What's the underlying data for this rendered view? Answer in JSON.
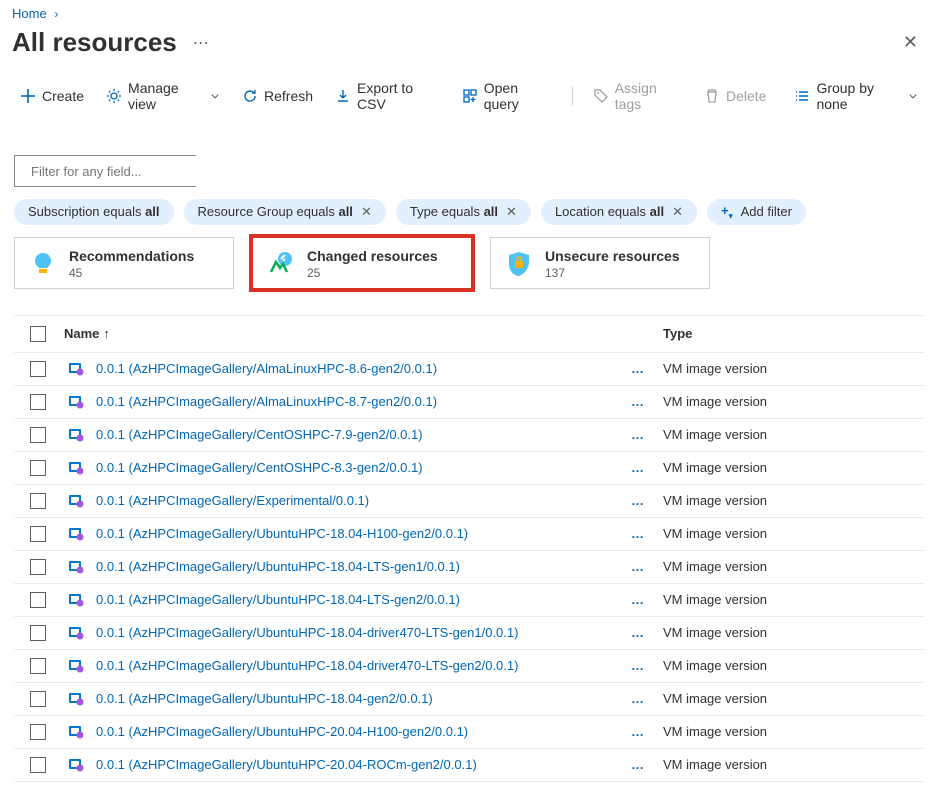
{
  "breadcrumb": {
    "home": "Home"
  },
  "title": "All resources",
  "cmdbar": {
    "create": "Create",
    "manage_view": "Manage view",
    "refresh": "Refresh",
    "export_csv": "Export to CSV",
    "open_query": "Open query",
    "assign_tags": "Assign tags",
    "delete": "Delete",
    "group_by": "Group by none"
  },
  "filter_placeholder": "Filter for any field...",
  "pills": {
    "subscription": {
      "label": "Subscription equals ",
      "value": "all"
    },
    "rg": {
      "label": "Resource Group equals ",
      "value": "all"
    },
    "type": {
      "label": "Type equals ",
      "value": "all"
    },
    "location": {
      "label": "Location equals ",
      "value": "all"
    },
    "add": "Add filter"
  },
  "cards": {
    "recommendations": {
      "title": "Recommendations",
      "count": "45"
    },
    "changed": {
      "title": "Changed resources",
      "count": "25"
    },
    "unsecure": {
      "title": "Unsecure resources",
      "count": "137"
    }
  },
  "columns": {
    "name": "Name",
    "type": "Type"
  },
  "rows": [
    {
      "name": "0.0.1 (AzHPCImageGallery/AlmaLinuxHPC-8.6-gen2/0.0.1)",
      "type": "VM image version"
    },
    {
      "name": "0.0.1 (AzHPCImageGallery/AlmaLinuxHPC-8.7-gen2/0.0.1)",
      "type": "VM image version"
    },
    {
      "name": "0.0.1 (AzHPCImageGallery/CentOSHPC-7.9-gen2/0.0.1)",
      "type": "VM image version"
    },
    {
      "name": "0.0.1 (AzHPCImageGallery/CentOSHPC-8.3-gen2/0.0.1)",
      "type": "VM image version"
    },
    {
      "name": "0.0.1 (AzHPCImageGallery/Experimental/0.0.1)",
      "type": "VM image version"
    },
    {
      "name": "0.0.1 (AzHPCImageGallery/UbuntuHPC-18.04-H100-gen2/0.0.1)",
      "type": "VM image version"
    },
    {
      "name": "0.0.1 (AzHPCImageGallery/UbuntuHPC-18.04-LTS-gen1/0.0.1)",
      "type": "VM image version"
    },
    {
      "name": "0.0.1 (AzHPCImageGallery/UbuntuHPC-18.04-LTS-gen2/0.0.1)",
      "type": "VM image version"
    },
    {
      "name": "0.0.1 (AzHPCImageGallery/UbuntuHPC-18.04-driver470-LTS-gen1/0.0.1)",
      "type": "VM image version"
    },
    {
      "name": "0.0.1 (AzHPCImageGallery/UbuntuHPC-18.04-driver470-LTS-gen2/0.0.1)",
      "type": "VM image version"
    },
    {
      "name": "0.0.1 (AzHPCImageGallery/UbuntuHPC-18.04-gen2/0.0.1)",
      "type": "VM image version"
    },
    {
      "name": "0.0.1 (AzHPCImageGallery/UbuntuHPC-20.04-H100-gen2/0.0.1)",
      "type": "VM image version"
    },
    {
      "name": "0.0.1 (AzHPCImageGallery/UbuntuHPC-20.04-ROCm-gen2/0.0.1)",
      "type": "VM image version"
    }
  ]
}
